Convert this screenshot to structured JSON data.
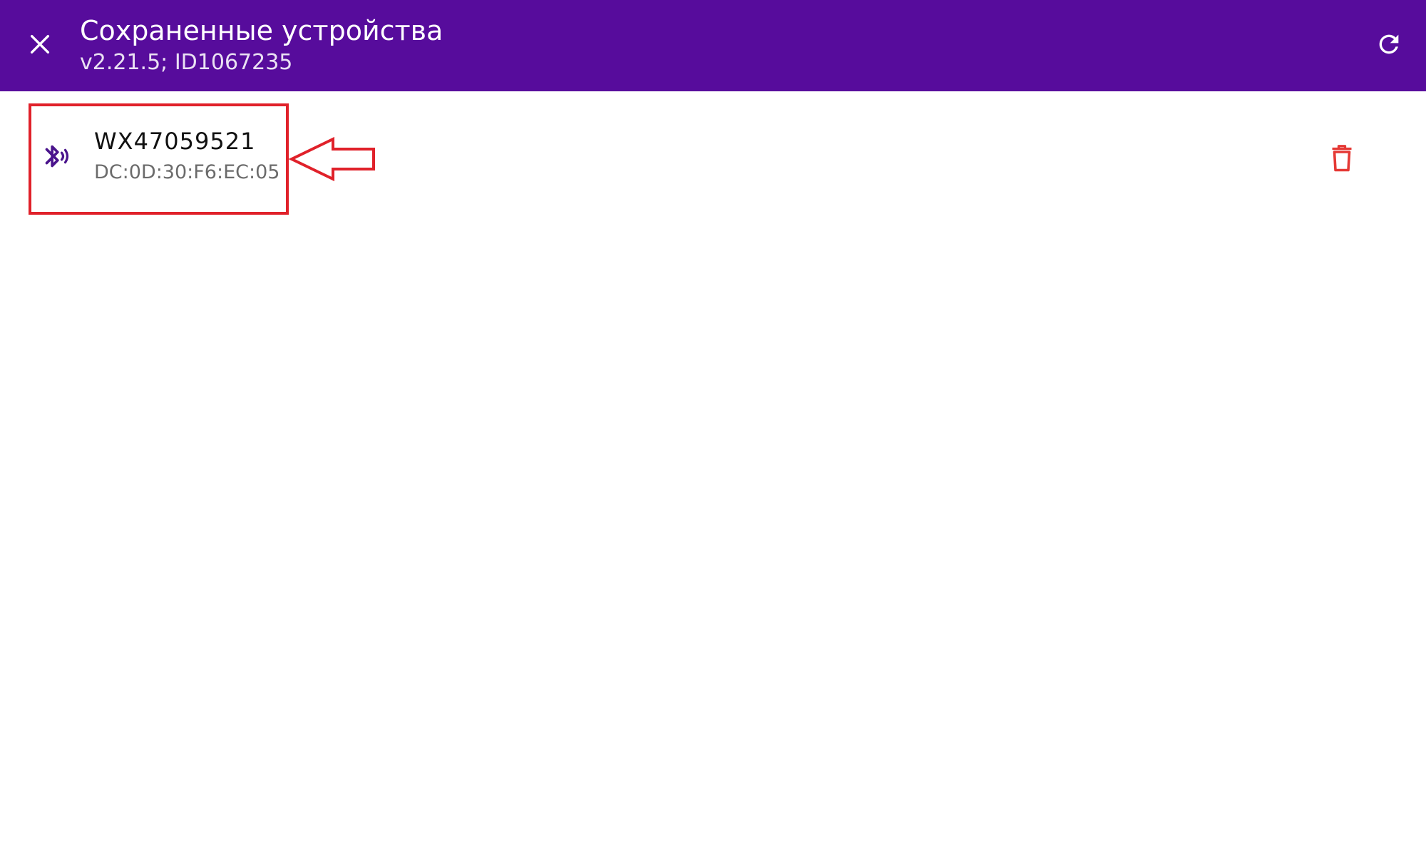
{
  "app_bar": {
    "title": "Сохраненные устройства",
    "subtitle": "v2.21.5; ID1067235",
    "background": "#570c9c",
    "close_icon": "close-icon",
    "refresh_icon": "refresh-icon"
  },
  "devices": [
    {
      "name": "WX47059521",
      "mac": "DC:0D:30:F6:EC:05",
      "icon": "bluetooth-connected-icon",
      "action_icon": "delete-icon"
    }
  ],
  "colors": {
    "accent": "#570c9c",
    "icon_purple": "#4a148c",
    "delete_red": "#e53935",
    "annotation_red": "#e0212a"
  }
}
